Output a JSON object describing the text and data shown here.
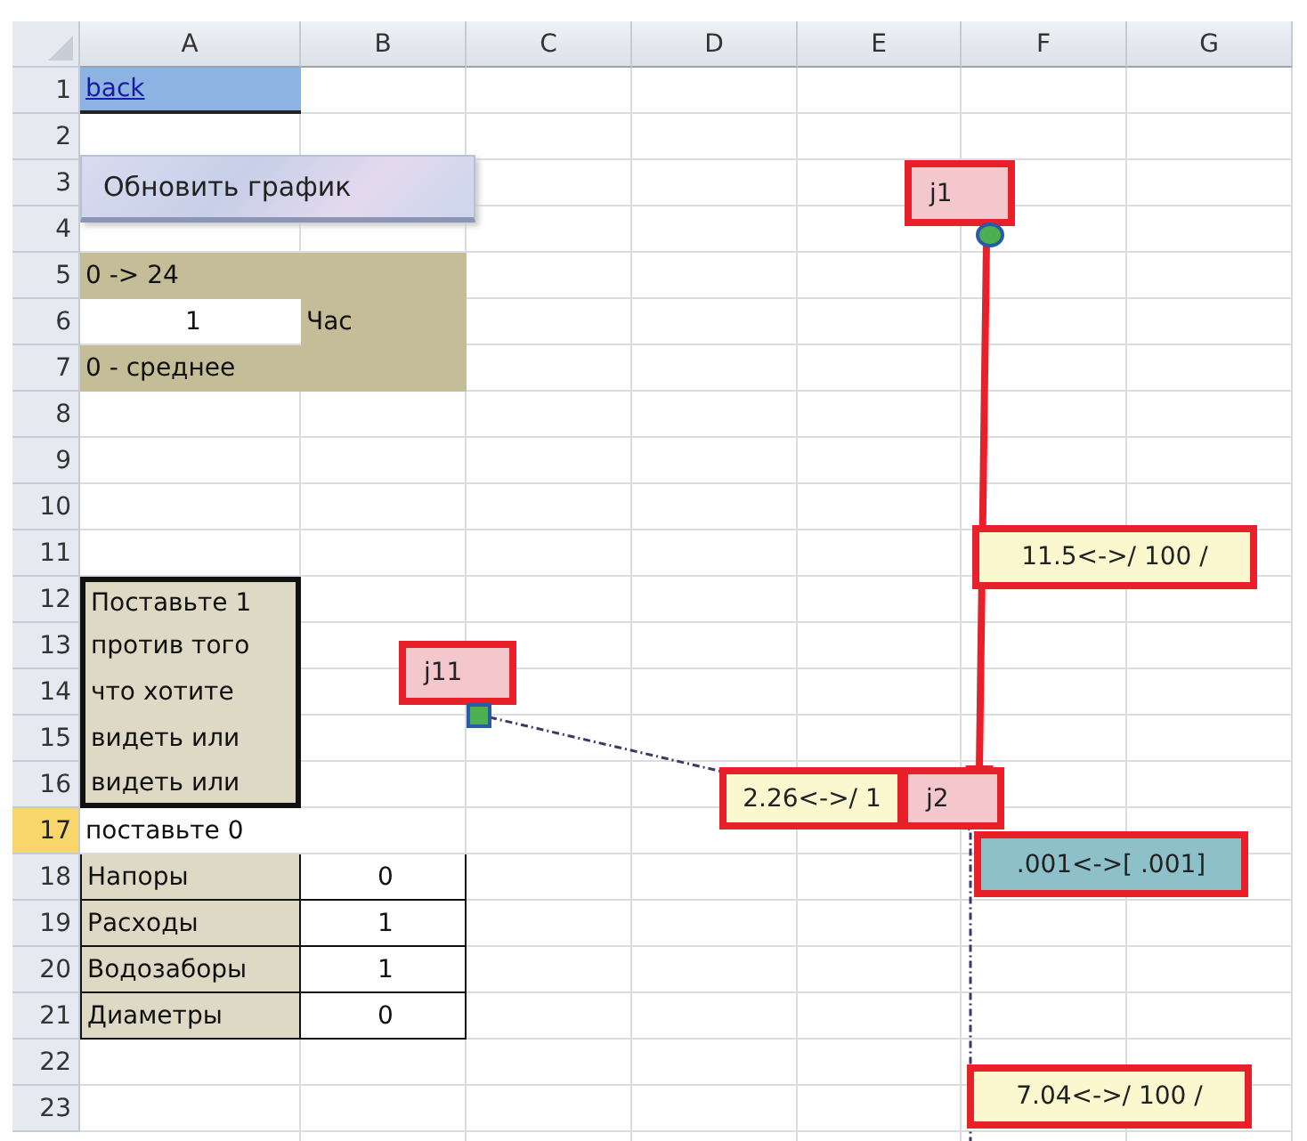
{
  "columns": [
    "A",
    "B",
    "C",
    "D",
    "E",
    "F",
    "G"
  ],
  "rows": [
    {
      "header": "1",
      "selected": false,
      "cells": [
        {
          "text": "back",
          "kind": "link"
        }
      ]
    },
    {
      "header": "2",
      "selected": false,
      "cells": []
    },
    {
      "header": "3",
      "selected": false,
      "cells": []
    },
    {
      "header": "4",
      "selected": false,
      "cells": []
    },
    {
      "header": "5",
      "selected": false,
      "cells": [
        {
          "text": "0 -> 24",
          "kind": "shaded"
        },
        {
          "kind": "shaded"
        }
      ]
    },
    {
      "header": "6",
      "selected": false,
      "cells": [
        {
          "text": "1",
          "kind": "input"
        },
        {
          "text": "Час",
          "kind": "shaded"
        }
      ]
    },
    {
      "header": "7",
      "selected": false,
      "cells": [
        {
          "text": "0 - среднее",
          "kind": "shaded"
        },
        {
          "kind": "shaded"
        }
      ]
    },
    {
      "header": "8",
      "selected": false,
      "cells": []
    },
    {
      "header": "9",
      "selected": false,
      "cells": []
    },
    {
      "header": "10",
      "selected": false,
      "cells": []
    },
    {
      "header": "11",
      "selected": false,
      "cells": []
    },
    {
      "header": "12",
      "selected": false,
      "cells": [
        {
          "text": "Поставьте 1",
          "kind": "note"
        }
      ]
    },
    {
      "header": "13",
      "selected": false,
      "cells": [
        {
          "text": "против того",
          "kind": "note"
        }
      ]
    },
    {
      "header": "14",
      "selected": false,
      "cells": [
        {
          "text": "что хотите",
          "kind": "note"
        }
      ]
    },
    {
      "header": "15",
      "selected": false,
      "cells": [
        {
          "text": "видеть или",
          "kind": "note"
        }
      ]
    },
    {
      "header": "16",
      "selected": false,
      "cells": [
        {
          "text": "видеть или",
          "kind": "note"
        }
      ]
    },
    {
      "header": "17",
      "selected": true,
      "cells": [
        {
          "text": "поставьте 0",
          "kind": "plain"
        }
      ]
    },
    {
      "header": "18",
      "selected": false,
      "cells": [
        {
          "text": "Напоры",
          "kind": "option"
        },
        {
          "text": "0",
          "kind": "value"
        }
      ]
    },
    {
      "header": "19",
      "selected": false,
      "cells": [
        {
          "text": "Расходы",
          "kind": "option"
        },
        {
          "text": "1",
          "kind": "value"
        }
      ]
    },
    {
      "header": "20",
      "selected": false,
      "cells": [
        {
          "text": "Водозаборы",
          "kind": "option"
        },
        {
          "text": "1",
          "kind": "value"
        }
      ]
    },
    {
      "header": "21",
      "selected": false,
      "cells": [
        {
          "text": "Диаметры",
          "kind": "option"
        },
        {
          "text": "0",
          "kind": "value"
        }
      ]
    },
    {
      "header": "22",
      "selected": false,
      "cells": []
    },
    {
      "header": "23",
      "selected": false,
      "cells": []
    }
  ],
  "button": {
    "label": "Обновить график"
  },
  "diagram": [
    {
      "text": "j1",
      "kind": "node"
    },
    {
      "text": "11.5<->/ 100 /",
      "kind": "flow"
    },
    {
      "text": "j11",
      "kind": "node"
    },
    {
      "text": "2.26<->/ 1",
      "kind": "flow"
    },
    {
      "text": "j2",
      "kind": "node"
    },
    {
      "text": ".001<->[ .001]",
      "kind": "status"
    },
    {
      "text": "7.04<->/ 100 /",
      "kind": "flow"
    }
  ]
}
